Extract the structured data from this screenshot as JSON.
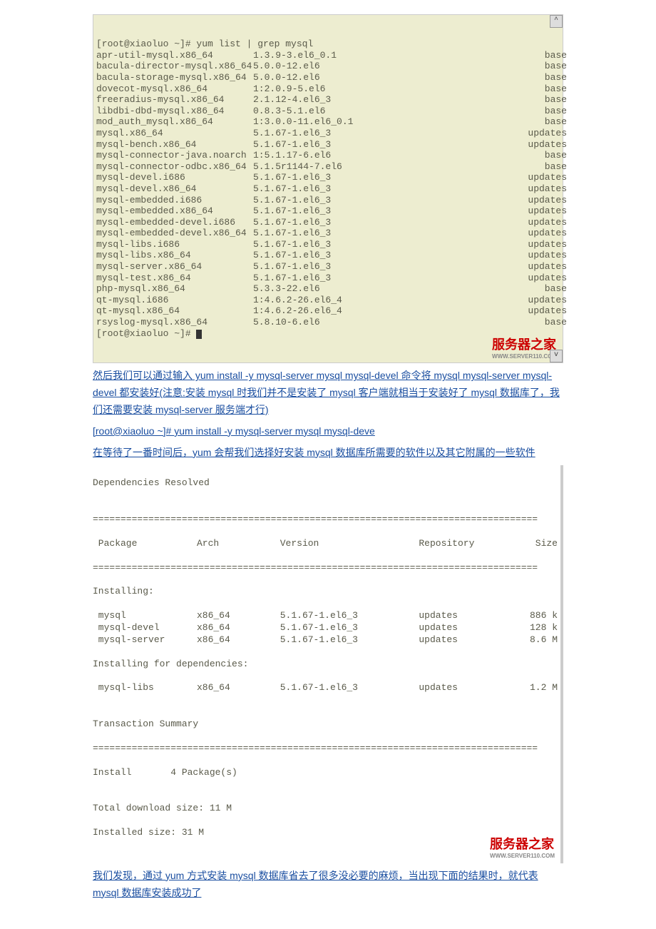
{
  "terminal1": {
    "prompt": "[root@xiaoluo ~]# yum list | grep mysql",
    "endPrompt": "[root@xiaoluo ~]# ",
    "rows": [
      {
        "pkg": "apr-util-mysql.x86_64",
        "ver": "1.3.9-3.el6_0.1",
        "repo": "base"
      },
      {
        "pkg": "bacula-director-mysql.x86_64",
        "ver": "5.0.0-12.el6",
        "repo": "base"
      },
      {
        "pkg": "bacula-storage-mysql.x86_64",
        "ver": "5.0.0-12.el6",
        "repo": "base"
      },
      {
        "pkg": "dovecot-mysql.x86_64",
        "ver": "1:2.0.9-5.el6",
        "repo": "base"
      },
      {
        "pkg": "freeradius-mysql.x86_64",
        "ver": "2.1.12-4.el6_3",
        "repo": "base"
      },
      {
        "pkg": "libdbi-dbd-mysql.x86_64",
        "ver": "0.8.3-5.1.el6",
        "repo": "base"
      },
      {
        "pkg": "mod_auth_mysql.x86_64",
        "ver": "1:3.0.0-11.el6_0.1",
        "repo": "base"
      },
      {
        "pkg": "mysql.x86_64",
        "ver": "5.1.67-1.el6_3",
        "repo": "updates"
      },
      {
        "pkg": "mysql-bench.x86_64",
        "ver": "5.1.67-1.el6_3",
        "repo": "updates"
      },
      {
        "pkg": "mysql-connector-java.noarch",
        "ver": "1:5.1.17-6.el6",
        "repo": "base"
      },
      {
        "pkg": "mysql-connector-odbc.x86_64",
        "ver": "5.1.5r1144-7.el6",
        "repo": "base"
      },
      {
        "pkg": "mysql-devel.i686",
        "ver": "5.1.67-1.el6_3",
        "repo": "updates"
      },
      {
        "pkg": "mysql-devel.x86_64",
        "ver": "5.1.67-1.el6_3",
        "repo": "updates"
      },
      {
        "pkg": "mysql-embedded.i686",
        "ver": "5.1.67-1.el6_3",
        "repo": "updates"
      },
      {
        "pkg": "mysql-embedded.x86_64",
        "ver": "5.1.67-1.el6_3",
        "repo": "updates"
      },
      {
        "pkg": "mysql-embedded-devel.i686",
        "ver": "5.1.67-1.el6_3",
        "repo": "updates"
      },
      {
        "pkg": "mysql-embedded-devel.x86_64",
        "ver": "5.1.67-1.el6_3",
        "repo": "updates"
      },
      {
        "pkg": "mysql-libs.i686",
        "ver": "5.1.67-1.el6_3",
        "repo": "updates"
      },
      {
        "pkg": "mysql-libs.x86_64",
        "ver": "5.1.67-1.el6_3",
        "repo": "updates"
      },
      {
        "pkg": "mysql-server.x86_64",
        "ver": "5.1.67-1.el6_3",
        "repo": "updates"
      },
      {
        "pkg": "mysql-test.x86_64",
        "ver": "5.1.67-1.el6_3",
        "repo": "updates"
      },
      {
        "pkg": "php-mysql.x86_64",
        "ver": "5.3.3-22.el6",
        "repo": "base"
      },
      {
        "pkg": "qt-mysql.i686",
        "ver": "1:4.6.2-26.el6_4",
        "repo": "updates"
      },
      {
        "pkg": "qt-mysql.x86_64",
        "ver": "1:4.6.2-26.el6_4",
        "repo": "updates"
      },
      {
        "pkg": "rsyslog-mysql.x86_64",
        "ver": "5.8.10-6.el6",
        "repo": "base"
      }
    ]
  },
  "prose1": "然后我们可以通过输入 yum install -y mysql-server mysql mysql-devel 命令将 mysql mysql-server mysql-devel 都安装好(注意:安装 mysql 时我们并不是安装了 mysql 客户端就相当于安装好了 mysql 数据库了，我们还需要安装 mysql-server 服务端才行)",
  "command": "[root@xiaoluo ~]# yum install -y mysql-server mysql mysql-deve",
  "prose2": "在等待了一番时间后，yum 会帮我们选择好安装 mysql 数据库所需要的软件以及其它附属的一些软件",
  "deps": {
    "title": "Dependencies Resolved",
    "divider": "================================================================================",
    "headers": {
      "c1": " Package",
      "c2": "Arch",
      "c3": "Version",
      "c4": "Repository",
      "c5": "Size"
    },
    "installing": "Installing:",
    "rows": [
      {
        "c1": " mysql",
        "c2": "x86_64",
        "c3": "5.1.67-1.el6_3",
        "c4": "updates",
        "c5": "886 k"
      },
      {
        "c1": " mysql-devel",
        "c2": "x86_64",
        "c3": "5.1.67-1.el6_3",
        "c4": "updates",
        "c5": "128 k"
      },
      {
        "c1": " mysql-server",
        "c2": "x86_64",
        "c3": "5.1.67-1.el6_3",
        "c4": "updates",
        "c5": "8.6 M"
      }
    ],
    "depHeader": "Installing for dependencies:",
    "depRows": [
      {
        "c1": " mysql-libs",
        "c2": "x86_64",
        "c3": "5.1.67-1.el6_3",
        "c4": "updates",
        "c5": "1.2 M"
      }
    ],
    "summary": "Transaction Summary",
    "installLine": "Install       4 Package(s)",
    "dl": "Total download size: 11 M",
    "inst": "Installed size: 31 M"
  },
  "prose3": "我们发现，通过 yum 方式安装 mysql 数据库省去了很多没必要的麻烦，当出现下面的结果时，就代表 mysql 数据库安装成功了",
  "watermark": {
    "main": "服务器之家",
    "sub": "WWW.SERVER110.COM"
  }
}
